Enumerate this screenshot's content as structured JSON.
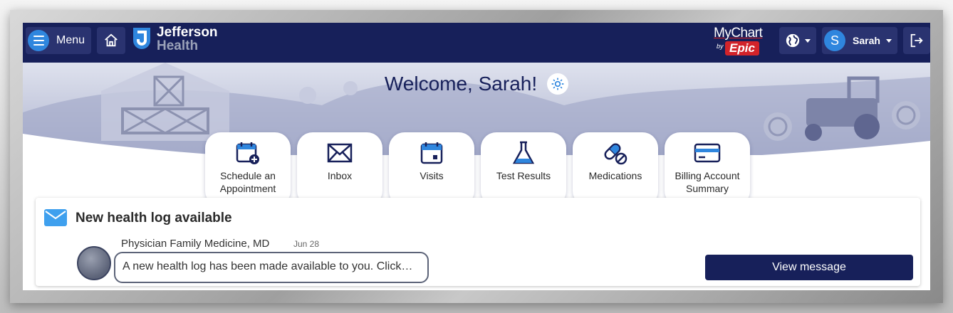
{
  "header": {
    "menu_label": "Menu",
    "brand_line1": "Jefferson",
    "brand_line2": "Health",
    "mychart_top": "MyChart",
    "mychart_by": "by",
    "mychart_epic": "Epic",
    "user_initial": "S",
    "user_name": "Sarah"
  },
  "welcome": {
    "text": "Welcome, Sarah!"
  },
  "quick_links": [
    {
      "label": "Schedule an Appointment",
      "icon": "calendar-plus-icon"
    },
    {
      "label": "Inbox",
      "icon": "envelope-icon"
    },
    {
      "label": "Visits",
      "icon": "calendar-icon"
    },
    {
      "label": "Test Results",
      "icon": "flask-icon"
    },
    {
      "label": "Medications",
      "icon": "pill-icon"
    },
    {
      "label": "Billing Account Summary",
      "icon": "credit-card-icon"
    }
  ],
  "message_card": {
    "title": "New health log available",
    "sender": "Physician Family Medicine, MD",
    "date": "Jun 28",
    "preview": "A new health log has been made available to you. Click…",
    "action_label": "View message"
  },
  "colors": {
    "navy": "#17205a",
    "accent_blue": "#2f86de",
    "epic_red": "#d2232a"
  }
}
